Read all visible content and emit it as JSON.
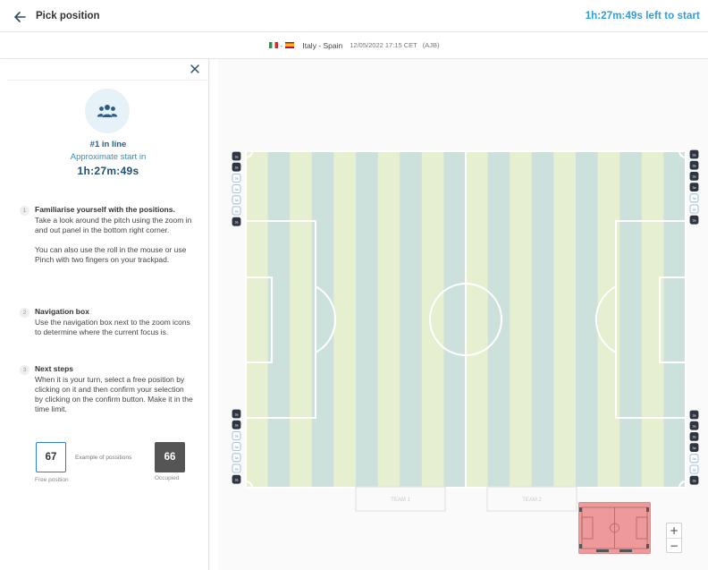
{
  "header": {
    "title": "Pick position",
    "countdown": "1h:27m:49s left to start"
  },
  "match": {
    "name": "Italy - Spain",
    "date": "12/05/2022 17:15 CET",
    "code": "(AJB)",
    "flags": [
      "italy-flag",
      "spain-flag"
    ]
  },
  "queue": {
    "position": "#1 in line",
    "approx_label": "Approximate start in",
    "time": "1h:27m:49s"
  },
  "steps": [
    {
      "num": "1",
      "title": "Familiarise yourself with the positions.",
      "paragraphs": [
        "Take a look around the pitch using the zoom in and out panel in the bottom right corner.",
        "You can also use the roll in the mouse or use Pinch with two fingers on your trackpad."
      ]
    },
    {
      "num": "2",
      "title": "Navigation box",
      "paragraphs": [
        "Use the navigation box next to the zoom icons to determine where the current focus is."
      ]
    },
    {
      "num": "3",
      "title": "Next steps",
      "paragraphs": [
        "When it is your turn, select a free position by clicking on it and then confirm your selection by clicking on the confirm button. Make it in the time limit."
      ]
    }
  ],
  "example": {
    "free_value": "67",
    "occupied_value": "66",
    "label": "Example of possitions",
    "free_caption": "Free position",
    "occupied_caption": "Occupied"
  },
  "pitch": {
    "seat_label": "3a",
    "seat_columns": [
      {
        "side": "left-top",
        "states": [
          "occupied",
          "occupied",
          "free",
          "free",
          "free",
          "free",
          "occupied"
        ]
      },
      {
        "side": "right-top",
        "states": [
          "occupied",
          "occupied",
          "occupied",
          "occupied",
          "free",
          "free",
          "occupied"
        ]
      },
      {
        "side": "left-bottom",
        "states": [
          "occupied",
          "occupied",
          "free",
          "free",
          "free",
          "free",
          "occupied"
        ]
      },
      {
        "side": "right-bottom",
        "states": [
          "occupied",
          "occupied",
          "occupied",
          "occupied",
          "free",
          "free",
          "occupied"
        ]
      }
    ],
    "team_labels": [
      "TEAM 1",
      "TEAM 2"
    ],
    "colors": {
      "stripe_a": "#e6efcf",
      "stripe_b": "#cde1dc",
      "line": "#ffffff",
      "occupied_seat": "#2e3440",
      "free_seat_border": "#8ab0d8",
      "minimap_fill": "#ee9a9a"
    }
  },
  "zoom": {
    "in_label": "+",
    "out_label": "−"
  }
}
